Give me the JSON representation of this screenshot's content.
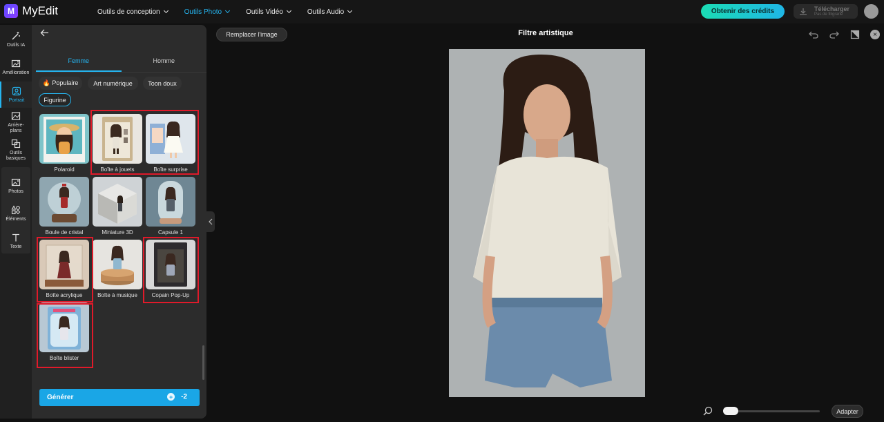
{
  "app": {
    "name": "MyEdit",
    "logo_letter": "M"
  },
  "topnav": {
    "items": [
      {
        "label": "Outils de conception",
        "active": false
      },
      {
        "label": "Outils Photo",
        "active": true
      },
      {
        "label": "Outils Vidéo",
        "active": false
      },
      {
        "label": "Outils Audio",
        "active": false
      }
    ],
    "credits_button": "Obtenir des crédits",
    "download_label": "Télécharger",
    "download_sub": "Pas de filigrane",
    "accent": "#25b5f0"
  },
  "leftrail": {
    "items": [
      {
        "label": "Outils IA",
        "icon": "magic-wand-icon"
      },
      {
        "label": "Amélioration",
        "icon": "enhance-icon"
      },
      {
        "label": "Portrait",
        "icon": "portrait-icon",
        "active": true
      },
      {
        "label": "Arrière-plans",
        "icon": "background-icon"
      },
      {
        "label": "Outils basiques",
        "icon": "crop-icon"
      },
      {
        "label": "Photos",
        "icon": "image-icon"
      },
      {
        "label": "Éléments",
        "icon": "shapes-icon"
      },
      {
        "label": "Texte",
        "icon": "text-icon"
      }
    ]
  },
  "panel": {
    "tabs": [
      {
        "label": "Femme",
        "active": true
      },
      {
        "label": "Homme",
        "active": false
      }
    ],
    "chips": [
      {
        "label": "🔥 Populaire",
        "selected": false
      },
      {
        "label": "Art numérique",
        "selected": false
      },
      {
        "label": "Toon doux",
        "selected": false
      },
      {
        "label": "Figurine",
        "selected": true
      }
    ],
    "styles": [
      {
        "label": "Polaroid",
        "highlighted": false
      },
      {
        "label": "Boîte à jouets",
        "highlighted": true
      },
      {
        "label": "Boîte surprise",
        "highlighted": true
      },
      {
        "label": "Boule de cristal",
        "highlighted": false
      },
      {
        "label": "Miniature 3D",
        "highlighted": false
      },
      {
        "label": "Capsule 1",
        "highlighted": false
      },
      {
        "label": "Boîte acrylique",
        "highlighted": true
      },
      {
        "label": "Boîte à musique",
        "highlighted": false
      },
      {
        "label": "Copain Pop-Up",
        "highlighted": true
      },
      {
        "label": "Boîte blister",
        "highlighted": true
      }
    ],
    "generate_label": "Générer",
    "generate_cost": "-2"
  },
  "canvas": {
    "replace_label": "Remplacer l'image",
    "title": "Filtre artistique",
    "fit_label": "Adapter",
    "zoom_level": 0.0
  }
}
